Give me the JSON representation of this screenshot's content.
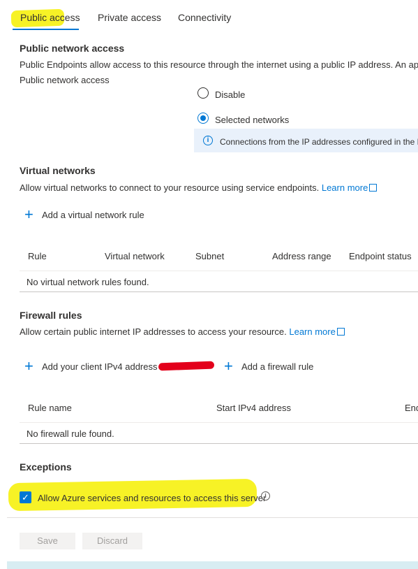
{
  "tabs": [
    {
      "label": "Public access"
    },
    {
      "label": "Private access"
    },
    {
      "label": "Connectivity"
    }
  ],
  "public_network": {
    "title": "Public network access",
    "description": "Public Endpoints allow access to this resource through the internet using a public IP address. An app",
    "field_label": "Public network access",
    "options": [
      {
        "label": "Disable",
        "selected": false
      },
      {
        "label": "Selected networks",
        "selected": true
      }
    ],
    "info_text": "Connections from the IP addresses configured in the F"
  },
  "virtual_networks": {
    "title": "Virtual networks",
    "description": "Allow virtual networks to connect to your resource using service endpoints.",
    "learn_more": "Learn more",
    "add_rule": "Add a virtual network rule",
    "columns": [
      "Rule",
      "Virtual network",
      "Subnet",
      "Address range",
      "Endpoint status"
    ],
    "empty_text": "No virtual network rules found."
  },
  "firewall_rules": {
    "title": "Firewall rules",
    "description": "Allow certain public internet IP addresses to access your resource.",
    "learn_more": "Learn more",
    "add_client_ip": "Add your client IPv4 address",
    "add_firewall_rule": "Add a firewall rule",
    "columns": [
      "Rule name",
      "Start IPv4 address",
      "End"
    ],
    "empty_text": "No firewall rule found."
  },
  "exceptions": {
    "title": "Exceptions",
    "allow_azure_label": "Allow Azure services and resources to access this server",
    "allow_azure_checked": true
  },
  "actions": {
    "save": "Save",
    "discard": "Discard"
  },
  "colors": {
    "accent": "#0078d4",
    "highlight": "#f6f000",
    "info_bg": "#e9f1fb"
  }
}
